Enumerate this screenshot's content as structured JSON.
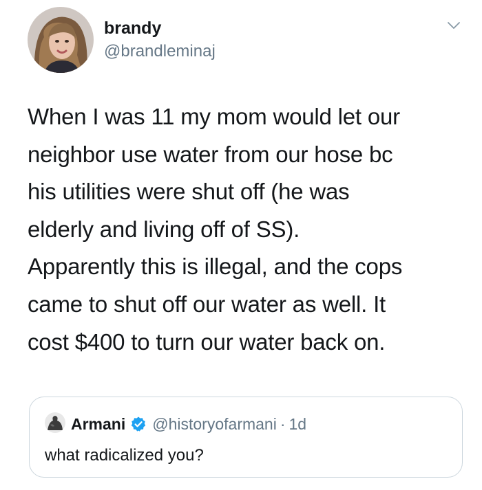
{
  "author": {
    "display_name": "brandy",
    "handle": "@brandleminaj",
    "avatar_icon": "user-avatar-photo"
  },
  "tweet": {
    "text": "When I was 11 my mom would let our\nneighbor use water from our hose bc\nhis utilities were shut off (he was\nelderly and living off of SS).\nApparently this is illegal, and the cops\ncame to shut off our water as well. It\ncost $400 to turn our water back on."
  },
  "quoted_tweet": {
    "display_name": "Armani",
    "verified": true,
    "handle": "@historyofarmani",
    "separator": "·",
    "time": "1d",
    "text": "what radicalized you?"
  },
  "colors": {
    "text_primary": "#14171a",
    "text_secondary": "#657786",
    "verified_blue": "#1da1f2",
    "card_border": "#ccd6dd"
  }
}
